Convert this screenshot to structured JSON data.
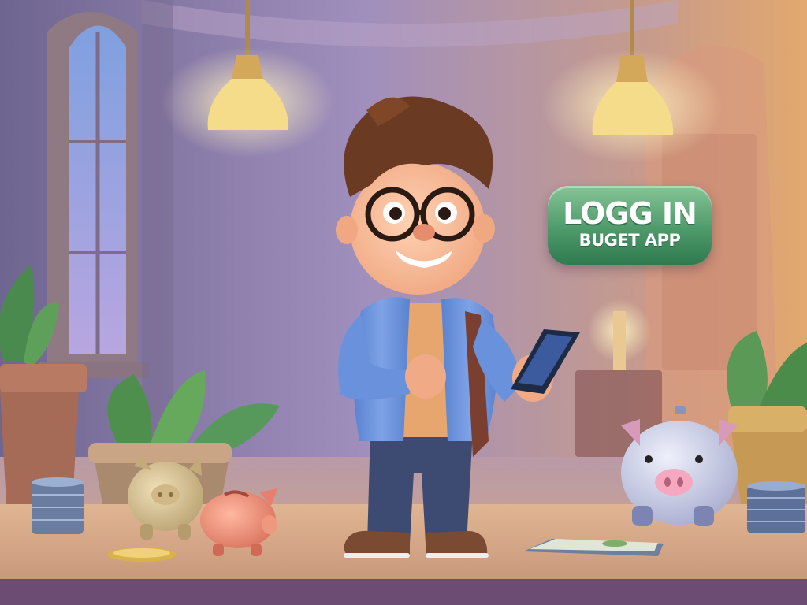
{
  "sign": {
    "line1": "LOGG IN",
    "line2": "BUGET APP"
  },
  "colors": {
    "sign_green": "#4e9a6b",
    "wall_lavender": "#9a8bb8",
    "floor_tan": "#c9a07a",
    "jacket_blue": "#6f95d8",
    "piggy_pink": "#e8907d"
  },
  "objects": [
    "window",
    "pendant-lamp",
    "pendant-lamp",
    "potted-plant",
    "potted-plant",
    "potted-plant",
    "character",
    "smartphone",
    "piggy-bank-gold",
    "piggy-bank-pink",
    "piggy-bank-blue",
    "coin-stack",
    "coin-stack",
    "cash-bundle",
    "coin"
  ]
}
